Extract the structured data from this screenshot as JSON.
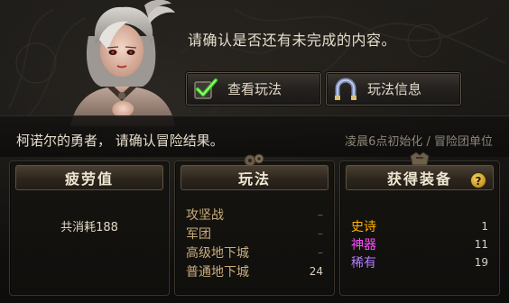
{
  "prompt": "请确认是否还有未完成的内容。",
  "buttons": {
    "view_mode": {
      "label": "查看玩法",
      "icon": "green-check-icon"
    },
    "mode_info": {
      "label": "玩法信息",
      "icon": "horseshoe-magnet-icon"
    }
  },
  "band": {
    "message": "柯诺尔的勇者， 请确认冒险结果。",
    "reset_note": "凌晨6点初始化 / 冒险团单位"
  },
  "fatigue": {
    "title": "疲劳值",
    "consumed_text": "共消耗188"
  },
  "modes": {
    "title": "玩法",
    "rows": [
      {
        "name": "攻坚战",
        "value": "–"
      },
      {
        "name": "军团",
        "value": "–"
      },
      {
        "name": "高级地下城",
        "value": "–"
      },
      {
        "name": "普通地下城",
        "value": "24"
      }
    ]
  },
  "gear": {
    "title": "获得装备",
    "help": "?",
    "rows": [
      {
        "name": "史诗",
        "value": "1",
        "color": "#ffb400"
      },
      {
        "name": "神器",
        "value": "11",
        "color": "#ff4dff"
      },
      {
        "name": "稀有",
        "value": "19",
        "color": "#b37dff"
      }
    ]
  }
}
